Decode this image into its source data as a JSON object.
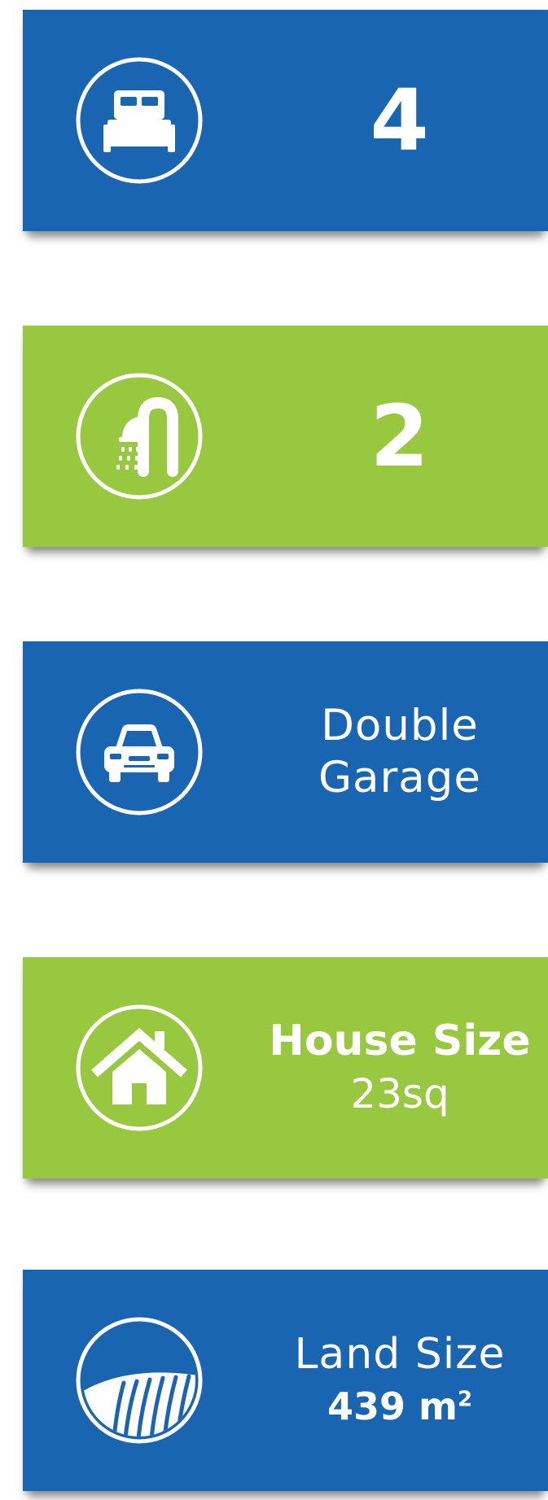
{
  "features": {
    "bedrooms": {
      "value": "4",
      "icon": "bed-icon",
      "color": "#1a65b1"
    },
    "bathrooms": {
      "value": "2",
      "icon": "shower-icon",
      "color": "#97c83f"
    },
    "garage": {
      "line1": "Double",
      "line2": "Garage",
      "icon": "car-icon",
      "color": "#1a65b1"
    },
    "house_size": {
      "label": "House Size",
      "value": "23sq",
      "icon": "house-icon",
      "color": "#97c83f"
    },
    "land_size": {
      "label": "Land Size",
      "value": "439 m",
      "unit_sup": "2",
      "icon": "land-icon",
      "color": "#1a65b1"
    }
  }
}
